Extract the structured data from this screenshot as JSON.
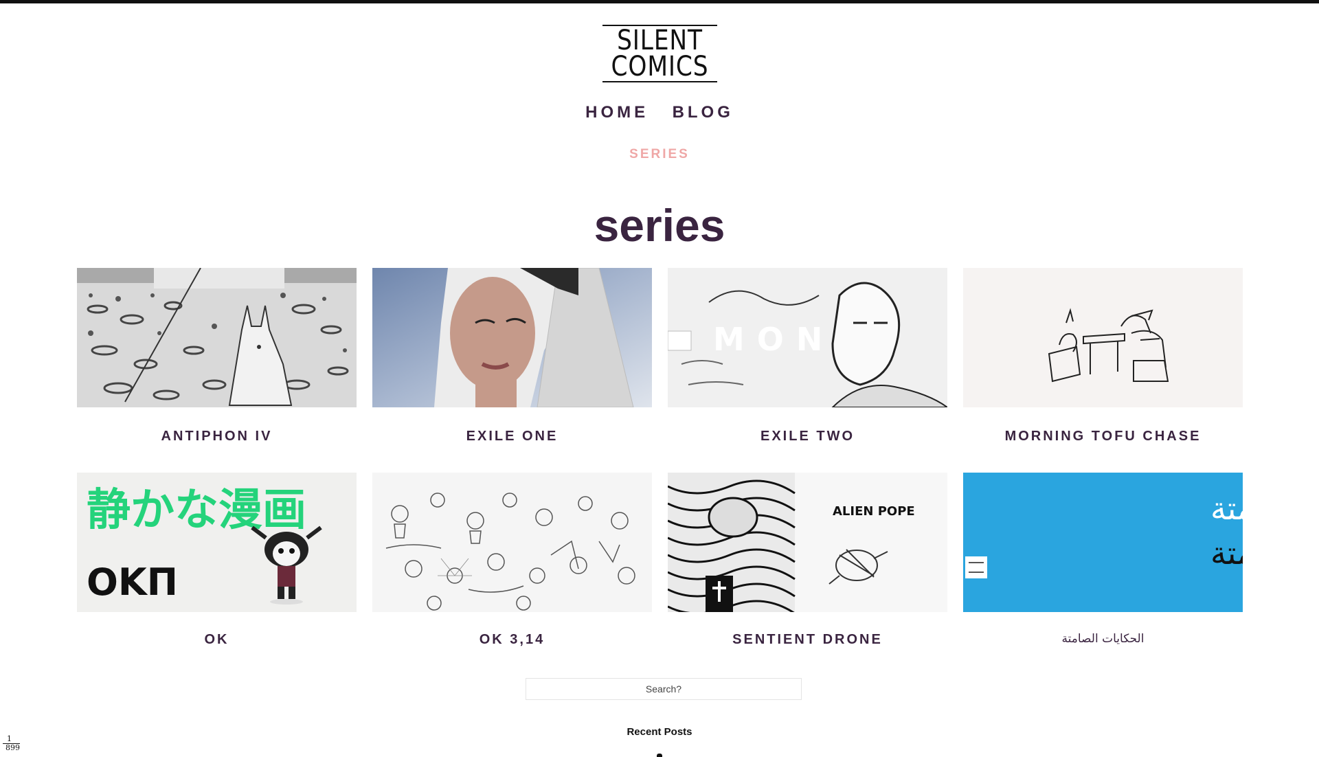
{
  "site": {
    "logo_line1": "SILENT",
    "logo_line2": "COMICS"
  },
  "nav": {
    "home": "HOME",
    "blog": "BLOG",
    "series": "SERIES"
  },
  "page_title": "series",
  "series": [
    {
      "title": "ANTIPHON IV"
    },
    {
      "title": "EXILE ONE"
    },
    {
      "title": "EXILE TWO",
      "thumb_text": "MON"
    },
    {
      "title": "MORNING TOFU CHASE"
    },
    {
      "title": "OK",
      "thumb_text_jp": "静かな漫画",
      "thumb_text_logo": "OKΠ"
    },
    {
      "title": "OK 3,14"
    },
    {
      "title": "SENTIENT DRONE",
      "thumb_text": "ALIEN POPE"
    },
    {
      "title": "الحكايات الصامتة",
      "thumb_text_1": "الحكايات الصامتة",
      "thumb_text_2": "الحكايات الصامتة"
    }
  ],
  "search": {
    "placeholder": "Search?"
  },
  "recent_posts": {
    "heading": "Recent Posts"
  },
  "pager": {
    "current": "1",
    "total": "899"
  },
  "colors": {
    "heading": "#3a2440",
    "active_nav": "#efa7a6",
    "tile_blue": "#2aa5df",
    "tile_green": "#24d37b"
  }
}
